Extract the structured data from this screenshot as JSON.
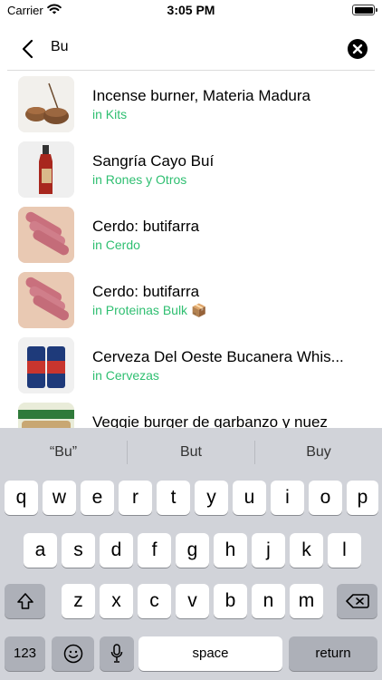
{
  "status_bar": {
    "carrier": "Carrier",
    "time": "3:05 PM"
  },
  "search": {
    "query": "Bu"
  },
  "results": [
    {
      "title": "Incense burner, Materia Madura",
      "category": "in Kits",
      "thumb": "incense-burner-image"
    },
    {
      "title": "Sangría Cayo Buí",
      "category": "in Rones y Otros",
      "thumb": "sangria-bottle-image"
    },
    {
      "title": "Cerdo: butifarra",
      "category": "in Cerdo",
      "thumb": "sausage-image"
    },
    {
      "title": "Cerdo: butifarra",
      "category": "in Proteinas Bulk",
      "emoji": "📦",
      "thumb": "sausage-image"
    },
    {
      "title": "Cerveza Del Oeste Bucanera Whis...",
      "category": "in Cervezas",
      "thumb": "beer-cans-image"
    },
    {
      "title": "Veggie burger de garbanzo y nuez",
      "category": "",
      "thumb": "veggie-burger-package-image"
    }
  ],
  "keyboard": {
    "suggestions": [
      "“Bu”",
      "But",
      "Buy"
    ],
    "row1": [
      "q",
      "w",
      "e",
      "r",
      "t",
      "y",
      "u",
      "i",
      "o",
      "p"
    ],
    "row2": [
      "a",
      "s",
      "d",
      "f",
      "g",
      "h",
      "j",
      "k",
      "l"
    ],
    "row3": [
      "z",
      "x",
      "c",
      "v",
      "b",
      "n",
      "m"
    ],
    "numbers_label": "123",
    "space_label": "space",
    "return_label": "return"
  },
  "colors": {
    "category_green": "#2fbf71",
    "keyboard_bg": "#d1d3d9",
    "function_key": "#adb0b8"
  }
}
